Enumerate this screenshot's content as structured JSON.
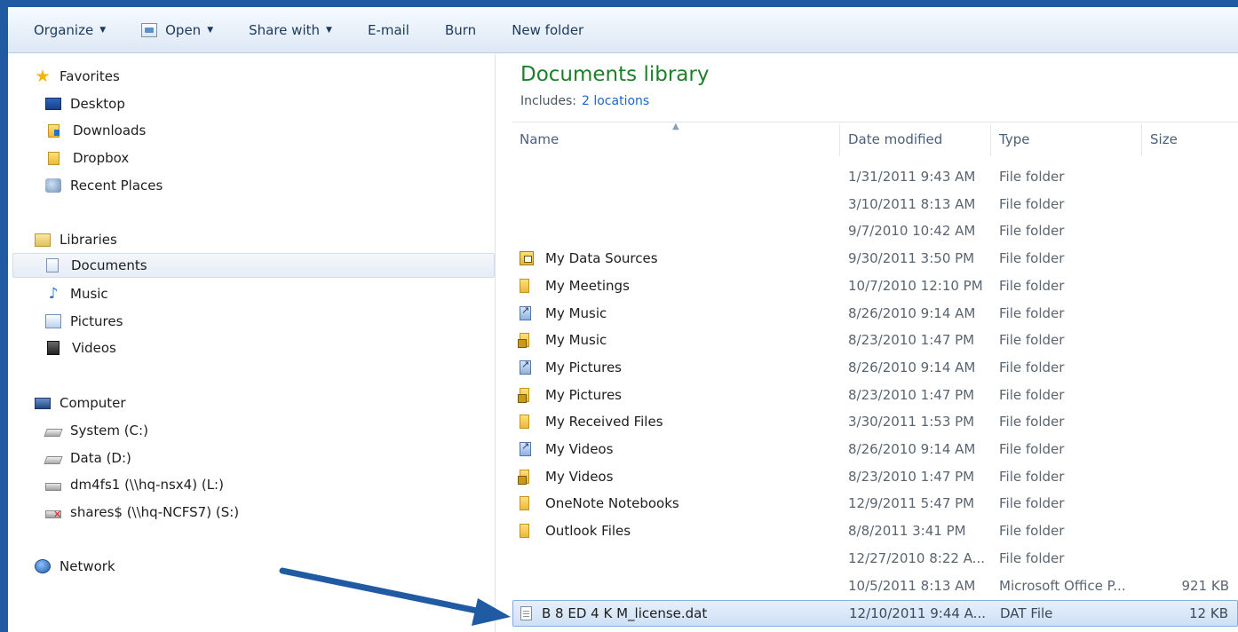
{
  "toolbar": {
    "organize": "Organize",
    "open": "Open",
    "share_with": "Share with",
    "email": "E-mail",
    "burn": "Burn",
    "new_folder": "New folder"
  },
  "nav": {
    "favorites": "Favorites",
    "desktop": "Desktop",
    "downloads": "Downloads",
    "dropbox": "Dropbox",
    "recent_places": "Recent Places",
    "libraries": "Libraries",
    "documents": "Documents",
    "music": "Music",
    "pictures": "Pictures",
    "videos": "Videos",
    "computer": "Computer",
    "system_c": "System (C:)",
    "data_d": "Data (D:)",
    "dm4fs1": "dm4fs1 (\\\\hq-nsx4) (L:)",
    "shares": "shares$ (\\\\hq-NCFS7) (S:)",
    "network": "Network"
  },
  "library": {
    "title": "Documents library",
    "includes_label": "Includes:",
    "includes_link": "2 locations"
  },
  "columns": {
    "name": "Name",
    "date": "Date modified",
    "type": "Type",
    "size": "Size"
  },
  "rows": [
    {
      "name": "",
      "date": "1/31/2011 9:43 AM",
      "type": "File folder",
      "size": "",
      "icon": "blank"
    },
    {
      "name": "",
      "date": "3/10/2011 8:13 AM",
      "type": "File folder",
      "size": "",
      "icon": "blank"
    },
    {
      "name": "",
      "date": "9/7/2010 10:42 AM",
      "type": "File folder",
      "size": "",
      "icon": "blank"
    },
    {
      "name": "My Data Sources",
      "date": "9/30/2011 3:50 PM",
      "type": "File folder",
      "size": "",
      "icon": "data-sources-folder-icon"
    },
    {
      "name": "My Meetings",
      "date": "10/7/2010 12:10 PM",
      "type": "File folder",
      "size": "",
      "icon": "folder-icon"
    },
    {
      "name": "My Music",
      "date": "8/26/2010 9:14 AM",
      "type": "File folder",
      "size": "",
      "icon": "shortcut-icon"
    },
    {
      "name": "My Music",
      "date": "8/23/2010 1:47 PM",
      "type": "File folder",
      "size": "",
      "icon": "locked-folder-icon"
    },
    {
      "name": "My Pictures",
      "date": "8/26/2010 9:14 AM",
      "type": "File folder",
      "size": "",
      "icon": "shortcut-icon"
    },
    {
      "name": "My Pictures",
      "date": "8/23/2010 1:47 PM",
      "type": "File folder",
      "size": "",
      "icon": "locked-folder-icon"
    },
    {
      "name": "My Received Files",
      "date": "3/30/2011 1:53 PM",
      "type": "File folder",
      "size": "",
      "icon": "folder-icon"
    },
    {
      "name": "My Videos",
      "date": "8/26/2010 9:14 AM",
      "type": "File folder",
      "size": "",
      "icon": "shortcut-icon"
    },
    {
      "name": "My Videos",
      "date": "8/23/2010 1:47 PM",
      "type": "File folder",
      "size": "",
      "icon": "locked-folder-icon"
    },
    {
      "name": "OneNote Notebooks",
      "date": "12/9/2011 5:47 PM",
      "type": "File folder",
      "size": "",
      "icon": "folder-icon"
    },
    {
      "name": "Outlook Files",
      "date": "8/8/2011 3:41 PM",
      "type": "File folder",
      "size": "",
      "icon": "folder-icon"
    },
    {
      "name": "",
      "date": "12/27/2010 8:22 A...",
      "type": "File folder",
      "size": "",
      "icon": "blank"
    },
    {
      "name": "",
      "date": "10/5/2011 8:13 AM",
      "type": "Microsoft Office P...",
      "size": "921 KB",
      "icon": "blank"
    },
    {
      "name": "B    8      ED     4       K         M_license.dat",
      "date": "12/10/2011 9:44 A...",
      "type": "DAT File",
      "size": "12 KB",
      "icon": "file-icon",
      "selected": true
    }
  ]
}
